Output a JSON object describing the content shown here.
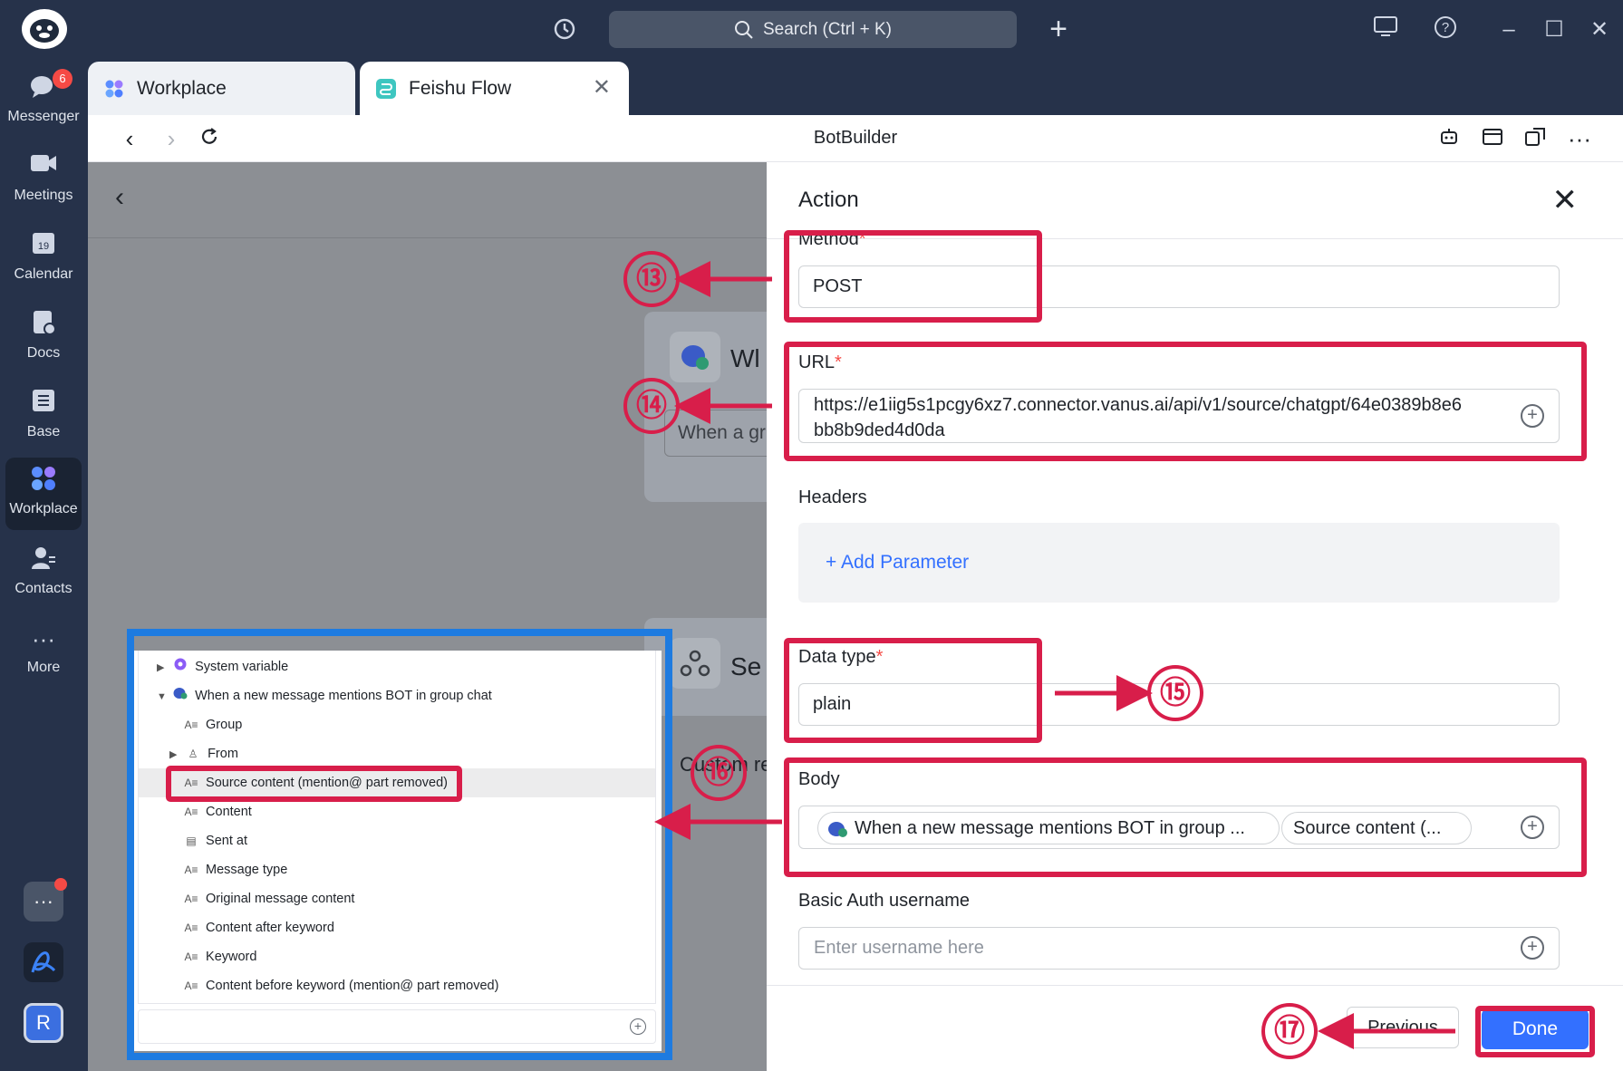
{
  "topbar": {
    "search_placeholder": "Search (Ctrl + K)"
  },
  "nav": {
    "items": [
      {
        "label": "Messenger",
        "badge": "6"
      },
      {
        "label": "Meetings"
      },
      {
        "label": "Calendar",
        "icon_text": "19"
      },
      {
        "label": "Docs"
      },
      {
        "label": "Base"
      },
      {
        "label": "Workplace"
      },
      {
        "label": "Contacts"
      },
      {
        "label": "More"
      }
    ],
    "avatar_letter": "R"
  },
  "tabs": [
    {
      "label": "Workplace"
    },
    {
      "label": "Feishu Flow"
    }
  ],
  "toolbar": {
    "title": "BotBuilder"
  },
  "canvas": {
    "node1_title": "Wl",
    "node1_input": "When a gr",
    "node2_title": "Se",
    "custom_text": "Custom re"
  },
  "panel": {
    "title": "Action",
    "method": {
      "label": "Method",
      "value": "POST"
    },
    "url": {
      "label": "URL",
      "value": "https://e1iig5s1pcgy6xz7.connector.vanus.ai/api/v1/source/chatgpt/64e0389b8e6bb8b9ded4d0da",
      "line1": "https://e1iig5s1pcgy6xz7.connector.vanus.ai/api/v1/source/chatgpt/64e0389b8e6",
      "line2": "bb8b9ded4d0da"
    },
    "headers": {
      "label": "Headers",
      "add_label": "+ Add Parameter"
    },
    "data_type": {
      "label": "Data type",
      "value": "plain"
    },
    "body": {
      "label": "Body",
      "tag1": "When a new message mentions BOT in group ...",
      "tag2": "Source content (..."
    },
    "basic_auth": {
      "label": "Basic Auth username",
      "placeholder": "Enter username here"
    },
    "previous_label": "Previous",
    "done_label": "Done"
  },
  "inset_tree": {
    "rows": [
      {
        "label": "System variable",
        "expand": "collapsed",
        "icon": "system-icon"
      },
      {
        "label": "When a new message mentions BOT in group chat",
        "expand": "expanded",
        "icon": "chat-icon"
      },
      {
        "label": "Group",
        "icon": "text-icon"
      },
      {
        "label": "From",
        "expand": "collapsed",
        "icon": "user-icon"
      },
      {
        "label": "Source content (mention@ part removed)",
        "icon": "text-icon",
        "selected": true
      },
      {
        "label": "Content",
        "icon": "text-icon"
      },
      {
        "label": "Sent at",
        "icon": "calendar-icon"
      },
      {
        "label": "Message type",
        "icon": "text-icon"
      },
      {
        "label": "Original message content",
        "icon": "text-icon"
      },
      {
        "label": "Content after keyword",
        "icon": "text-icon"
      },
      {
        "label": "Keyword",
        "icon": "text-icon"
      },
      {
        "label": "Content before keyword (mention@ part removed)",
        "icon": "text-icon"
      }
    ]
  },
  "annotations": {
    "n13": "⑬",
    "n14": "⑭",
    "n15": "⑮",
    "n16": "⑯",
    "n17": "⑰",
    "red": "#d81e4a",
    "blue": "#1e7be0"
  },
  "colors": {
    "accent": "#3370ff",
    "sidebar": "#26324a",
    "required": "#f54a45"
  }
}
